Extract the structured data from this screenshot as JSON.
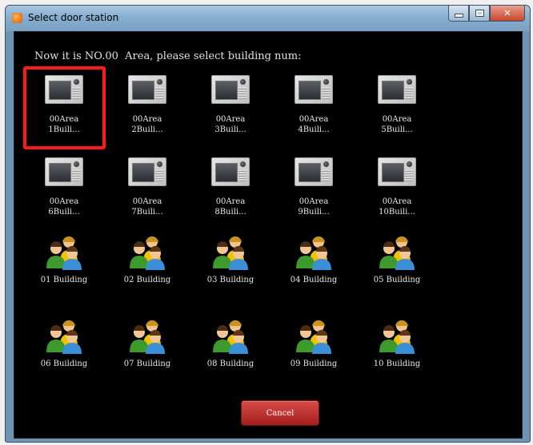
{
  "window": {
    "title": "Select door station",
    "icons": {
      "app": "app-icon",
      "minimize": "minimize-icon",
      "maximize": "maximize-icon",
      "close": "close-icon"
    }
  },
  "header": {
    "text": "Now it is NO.00  Area, please select building num:"
  },
  "stations": [
    {
      "line1": "00Area",
      "line2": "1Buili...",
      "icon": "door-station-icon",
      "selected": true
    },
    {
      "line1": "00Area",
      "line2": "2Buili...",
      "icon": "door-station-icon",
      "selected": false
    },
    {
      "line1": "00Area",
      "line2": "3Buili...",
      "icon": "door-station-icon",
      "selected": false
    },
    {
      "line1": "00Area",
      "line2": "4Buili...",
      "icon": "door-station-icon",
      "selected": false
    },
    {
      "line1": "00Area",
      "line2": "5Buili...",
      "icon": "door-station-icon",
      "selected": false
    },
    {
      "line1": "00Area",
      "line2": "6Buili...",
      "icon": "door-station-icon",
      "selected": false
    },
    {
      "line1": "00Area",
      "line2": "7Buili...",
      "icon": "door-station-icon",
      "selected": false
    },
    {
      "line1": "00Area",
      "line2": "8Buili...",
      "icon": "door-station-icon",
      "selected": false
    },
    {
      "line1": "00Area",
      "line2": "9Buili...",
      "icon": "door-station-icon",
      "selected": false
    },
    {
      "line1": "00Area",
      "line2": "10Buili...",
      "icon": "door-station-icon",
      "selected": false
    }
  ],
  "buildings": [
    {
      "label": "01 Building",
      "icon": "people-group-icon"
    },
    {
      "label": "02 Building",
      "icon": "people-group-icon"
    },
    {
      "label": "03 Building",
      "icon": "people-group-icon"
    },
    {
      "label": "04 Building",
      "icon": "people-group-icon"
    },
    {
      "label": "05 Building",
      "icon": "people-group-icon"
    },
    {
      "label": "06 Building",
      "icon": "people-group-icon"
    },
    {
      "label": "07 Building",
      "icon": "people-group-icon"
    },
    {
      "label": "08 Building",
      "icon": "people-group-icon"
    },
    {
      "label": "09 Building",
      "icon": "people-group-icon"
    },
    {
      "label": "10 Building",
      "icon": "people-group-icon"
    }
  ],
  "footer": {
    "cancel_label": "Cancel"
  },
  "colors": {
    "background": "#000000",
    "selection": "#ff1a1a",
    "cancel": "#c0302c"
  }
}
